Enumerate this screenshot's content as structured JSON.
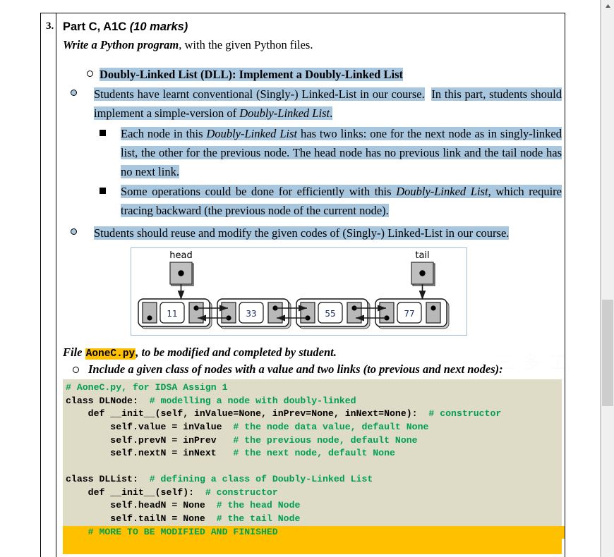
{
  "question": {
    "number": "3.",
    "title_main": "Part C, A1C ",
    "title_marks": "(10 marks)",
    "intro_em": "Write a Python program",
    "intro_rest": ", with the given Python files."
  },
  "bullets": {
    "dll_heading": "Doubly-Linked List (DLL):   Implement a Doubly-Linked List",
    "item1_a": "Students have learnt conventional (Singly-) Linked-List in our course.",
    "item1_b": "In this part, students should implement a simple-version of ",
    "item1_em": "Doubly-Linked List",
    "item1_end": ".",
    "sub1_pre": "Each node in this ",
    "sub1_em": "Doubly-Linked List",
    "sub1_post": " has two links: one for the next node as in singly-linked list, the other for the previous node.   The head node has no previous link and the tail node has no next link.",
    "sub2_pre": "Some operations could be done for efficiently with this ",
    "sub2_em": "Doubly-Linked List",
    "sub2_post": ", which require tracing backward (the previous node of the current node).",
    "item2": "Students should reuse and modify the given codes of (Singly-) Linked-List in our course."
  },
  "diagram": {
    "head_label": "head",
    "tail_label": "tail",
    "node_values": [
      "11",
      "33",
      "55",
      "77"
    ]
  },
  "file_section": {
    "prefix": "File ",
    "file_name": "AoneC.py",
    "suffix": ", to be modified and completed by student.",
    "include_line": "Include a given class of nodes with a value and two links (to previous and next nodes):"
  },
  "code": {
    "lines": [
      {
        "text": "# AoneC.py, for IDSA Assign 1",
        "style": "comment"
      },
      {
        "code": "class DLNode:  ",
        "comment": "# modelling a node with doubly-linked"
      },
      {
        "code": "    def __init__(self, inValue=None, inPrev=None, inNext=None):  ",
        "comment": "# constructor"
      },
      {
        "code": "        self.value = inValue  ",
        "comment": "# the node data value, default None"
      },
      {
        "code": "        self.prevN = inPrev   ",
        "comment": "# the previous node, default None"
      },
      {
        "code": "        self.nextN = inNext   ",
        "comment": "# the next node, default None"
      },
      {
        "code": "",
        "comment": ""
      },
      {
        "code": "class DLList:  ",
        "comment": "# defining a class of Doubly-Linked List"
      },
      {
        "code": "    def __init__(self):  ",
        "comment": "# constructor"
      },
      {
        "code": "        self.headN = None  ",
        "comment": "# the head Node"
      },
      {
        "code": "        self.tailN = None  ",
        "comment": "# the tail Node"
      }
    ],
    "highlight_line": "    # MORE TO BE MODIFIED AND FINISHED"
  },
  "watermark": "三 多 工",
  "colors": {
    "text_highlight": "#a8c6de",
    "code_background": "#dedbc6",
    "code_comment": "#00a050",
    "highlight_yellow": "#ffc000",
    "diagram_border": "#9dbcd8",
    "scrollbar_thumb": "#cdcdcd"
  },
  "scrollbar": {
    "up_arrow": "scroll-up-arrow"
  }
}
